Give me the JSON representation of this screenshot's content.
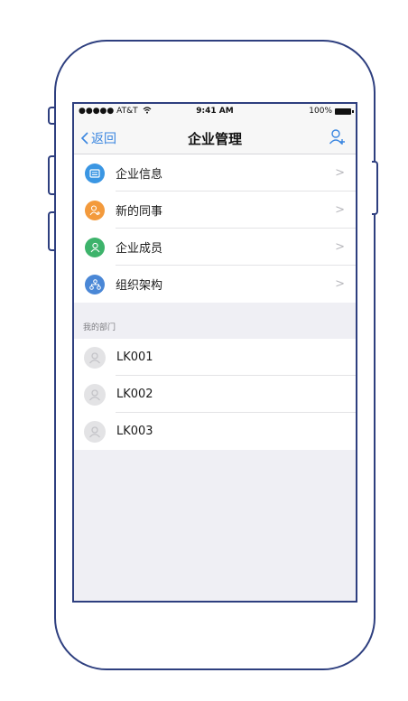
{
  "status_bar": {
    "carrier": "●●●●● AT&T",
    "time": "9:41 AM",
    "battery": "100%"
  },
  "nav": {
    "back_label": "返回",
    "title": "企业管理",
    "add_icon": "add-user-icon"
  },
  "menu": [
    {
      "label": "企业信息",
      "icon": "company-info-icon",
      "color": "#3a96e3"
    },
    {
      "label": "新的同事",
      "icon": "new-colleague-icon",
      "color": "#f39a3c"
    },
    {
      "label": "企业成员",
      "icon": "members-icon",
      "color": "#3db36b"
    },
    {
      "label": "组织架构",
      "icon": "org-structure-icon",
      "color": "#4a87d6"
    }
  ],
  "section_title": "我的部门",
  "departments": [
    {
      "name": "LK001"
    },
    {
      "name": "LK002"
    },
    {
      "name": "LK003"
    }
  ],
  "colors": {
    "accent": "#3a86e0",
    "frame": "#2e3f7f",
    "background": "#efeff4"
  }
}
